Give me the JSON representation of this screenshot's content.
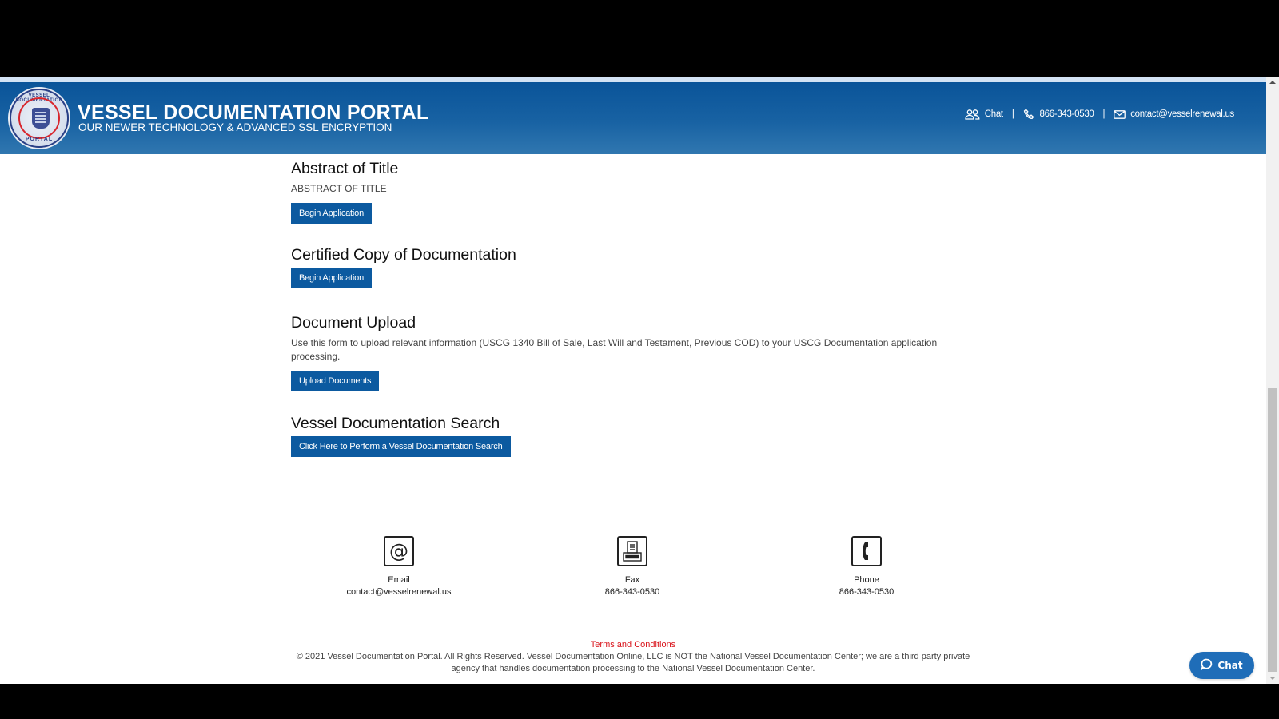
{
  "header": {
    "title": "VESSEL DOCUMENTATION PORTAL",
    "subtitle": "OUR NEWER TECHNOLOGY & ADVANCED SSL ENCRYPTION",
    "logo": {
      "top_text": "VESSEL DOCUMENTATION",
      "bottom_text": "PORTAL"
    },
    "links": {
      "chat": "Chat",
      "phone": "866-343-0530",
      "email": "contact@vesselrenewal.us",
      "separator": "|"
    },
    "icons": {
      "chat": "users-icon",
      "phone": "phone-icon",
      "email": "envelope-icon"
    }
  },
  "sections": [
    {
      "title": "Abstract of Title",
      "text": "ABSTRACT OF TITLE",
      "button": "Begin Application"
    },
    {
      "title": "Certified Copy of Documentation",
      "button": "Begin Application"
    },
    {
      "title": "Document Upload",
      "text": "Use this form to upload relevant information (USCG 1340 Bill of Sale, Last Will and Testament, Previous COD) to your USCG Documentation application processing.",
      "button": "Upload Documents"
    },
    {
      "title": "Vessel Documentation Search",
      "button": "Click Here to Perform a Vessel Documentation Search"
    }
  ],
  "contacts": [
    {
      "label": "Email",
      "value": "contact@vesselrenewal.us",
      "icon": "at-sign-icon"
    },
    {
      "label": "Fax",
      "value": "866-343-0530",
      "icon": "fax-icon"
    },
    {
      "label": "Phone",
      "value": "866-343-0530",
      "icon": "phone-icon"
    }
  ],
  "footer": {
    "terms": "Terms and Conditions",
    "copyright": "© 2021 Vessel Documentation Portal. All Rights Reserved. Vessel Documentation Online, LLC is NOT the National Vessel Documentation Center; we are a third party private agency that handles documentation processing to the National Vessel Documentation Center."
  },
  "chat_widget": {
    "label": "Chat"
  },
  "colors": {
    "header_blue": "#0a5499",
    "button_blue": "#0c5aa0",
    "terms_red": "#d9141b",
    "chat_blue": "#1f6db8"
  }
}
